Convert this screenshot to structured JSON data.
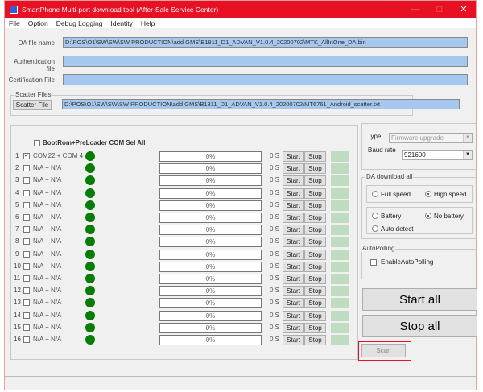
{
  "window": {
    "title": "SmartPhone Multi-port download tool (After-Sale Service Center)"
  },
  "menu": [
    "File",
    "Option",
    "Debug Logging",
    "Identity",
    "Help"
  ],
  "files": {
    "da_label": "DA file name",
    "da_value": "D:\\POS\\O1\\SW\\SW\\SW PRODUCTION\\add GMS\\B1811_D1_ADVAN_V1.0.4_20200702\\MTK_AllInOne_DA.bin",
    "auth_label": "Authentication file",
    "auth_value": "",
    "cert_label": "Certification File",
    "cert_value": "",
    "scatter_group": "Scatter Files",
    "scatter_button": "Scatter File",
    "scatter_value": "D:\\POS\\O1\\SW\\SW\\SW PRODUCTION\\add GMS\\B1811_D1_ADVAN_V1.0.4_20200702\\MT6761_Android_scatter.txt"
  },
  "ports": {
    "sel_all_label": "BootRom+PreLoader COM Sel All",
    "start_label": "Start",
    "stop_label": "Stop",
    "rows": [
      {
        "num": "1",
        "checked": true,
        "name": "COM22 + COM 4",
        "progress": "0%",
        "time": "0 S"
      },
      {
        "num": "2",
        "checked": false,
        "name": "N/A + N/A",
        "progress": "0%",
        "time": "0 S"
      },
      {
        "num": "3",
        "checked": false,
        "name": "N/A + N/A",
        "progress": "0%",
        "time": "0 S"
      },
      {
        "num": "4",
        "checked": false,
        "name": "N/A + N/A",
        "progress": "0%",
        "time": "0 S"
      },
      {
        "num": "5",
        "checked": false,
        "name": "N/A + N/A",
        "progress": "0%",
        "time": "0 S"
      },
      {
        "num": "6",
        "checked": false,
        "name": "N/A + N/A",
        "progress": "0%",
        "time": "0 S"
      },
      {
        "num": "7",
        "checked": false,
        "name": "N/A + N/A",
        "progress": "0%",
        "time": "0 S"
      },
      {
        "num": "8",
        "checked": false,
        "name": "N/A + N/A",
        "progress": "0%",
        "time": "0 S"
      },
      {
        "num": "9",
        "checked": false,
        "name": "N/A + N/A",
        "progress": "0%",
        "time": "0 S"
      },
      {
        "num": "10",
        "checked": false,
        "name": "N/A + N/A",
        "progress": "0%",
        "time": "0 S"
      },
      {
        "num": "11",
        "checked": false,
        "name": "N/A + N/A",
        "progress": "0%",
        "time": "0 S"
      },
      {
        "num": "12",
        "checked": false,
        "name": "N/A + N/A",
        "progress": "0%",
        "time": "0 S"
      },
      {
        "num": "13",
        "checked": false,
        "name": "N/A + N/A",
        "progress": "0%",
        "time": "0 S"
      },
      {
        "num": "14",
        "checked": false,
        "name": "N/A + N/A",
        "progress": "0%",
        "time": "0 S"
      },
      {
        "num": "15",
        "checked": false,
        "name": "N/A + N/A",
        "progress": "0%",
        "time": "0 S"
      },
      {
        "num": "16",
        "checked": false,
        "name": "N/A + N/A",
        "progress": "0%",
        "time": "0 S"
      }
    ]
  },
  "settings": {
    "type_label": "Type",
    "type_value": "Firmware upgrade",
    "baud_label": "Baud rate",
    "baud_value": "921600",
    "da_group": "DA download all",
    "full_speed": "Full speed",
    "high_speed": "High speed",
    "battery": "Battery",
    "no_battery": "No battery",
    "auto_detect": "Auto detect",
    "autopolling_group": "AutoPolling",
    "enable_autopolling": "EnableAutoPolling"
  },
  "actions": {
    "start_all": "Start all",
    "stop_all": "Stop all",
    "scan": "Scan"
  },
  "colors": {
    "titlebar": "#e81123",
    "led": "#067d06",
    "field": "#a6c8ee",
    "highlight": "#e81123"
  }
}
